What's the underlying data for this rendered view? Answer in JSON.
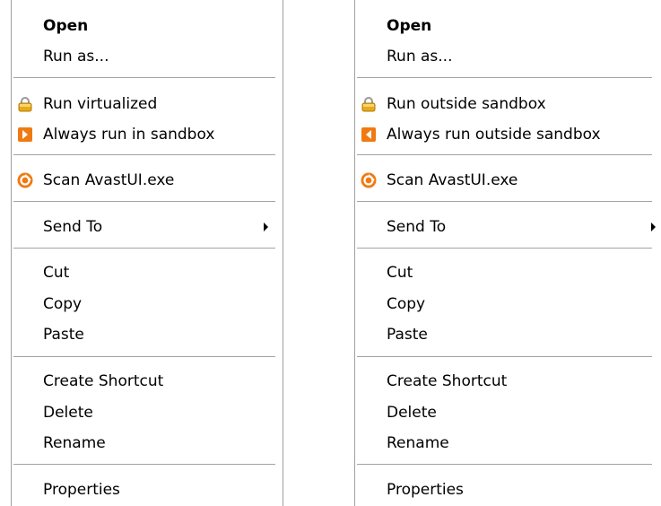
{
  "left_menu": {
    "open": "Open",
    "run_as": "Run as...",
    "sandbox_primary": "Run virtualized",
    "sandbox_secondary": "Always run in sandbox",
    "scan": "Scan AvastUI.exe",
    "send_to": "Send To",
    "cut": "Cut",
    "copy": "Copy",
    "paste": "Paste",
    "create_shortcut": "Create Shortcut",
    "delete": "Delete",
    "rename": "Rename",
    "properties": "Properties"
  },
  "right_menu": {
    "open": "Open",
    "run_as": "Run as...",
    "sandbox_primary": "Run outside sandbox",
    "sandbox_secondary": "Always run outside sandbox",
    "scan": "Scan AvastUI.exe",
    "send_to": "Send To",
    "cut": "Cut",
    "copy": "Copy",
    "paste": "Paste",
    "create_shortcut": "Create Shortcut",
    "delete": "Delete",
    "rename": "Rename",
    "properties": "Properties"
  },
  "icons": {
    "lock": "lock-icon",
    "sandbox_in": "arrow-right-icon",
    "sandbox_out": "arrow-left-icon",
    "scan": "avast-icon",
    "submenu": "submenu-arrow-icon"
  },
  "colors": {
    "separator": "#a3a3a3",
    "avast_orange": "#f07a12",
    "lock_gold": "#e8a91c"
  }
}
